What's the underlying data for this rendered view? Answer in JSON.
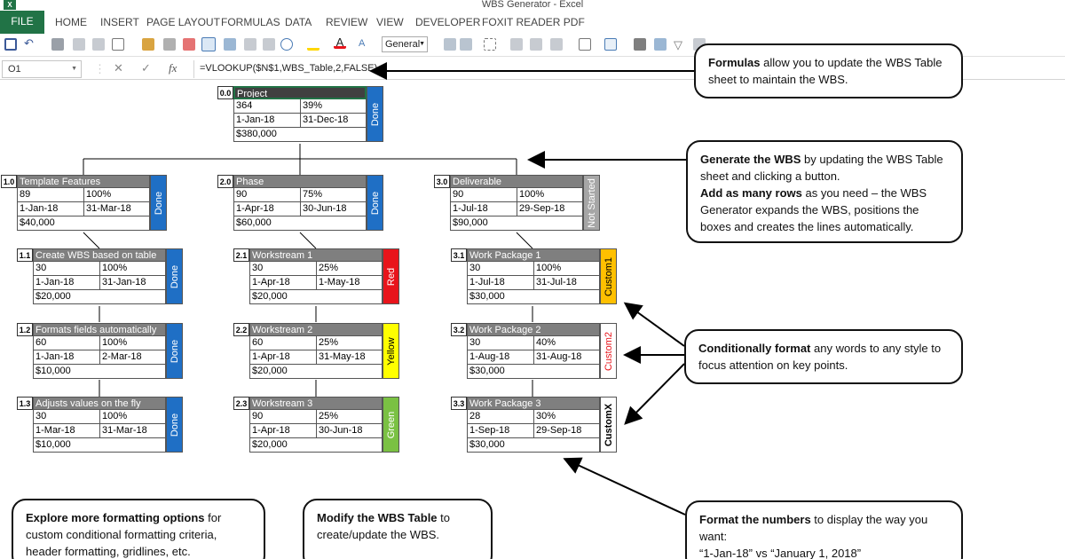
{
  "window": {
    "app_icon_label": "X",
    "title": "WBS Generator - Excel"
  },
  "ribbon": {
    "file_tab": "FILE",
    "tabs": [
      "HOME",
      "INSERT",
      "PAGE LAYOUT",
      "FORMULAS",
      "DATA",
      "REVIEW",
      "VIEW",
      "DEVELOPER",
      "FOXIT READER PDF"
    ]
  },
  "toolbar": {
    "number_format": "General"
  },
  "formula_bar": {
    "cell_ref": "O1",
    "cancel_icon": "✕",
    "enter_icon": "✓",
    "fx_label": "fx",
    "formula": "=VLOOKUP($N$1,WBS_Table,2,FALSE)"
  },
  "wbs": {
    "root": {
      "num": "0.0",
      "title": "Project",
      "a": "364",
      "b": "39%",
      "start": "1-Jan-18",
      "end": "31-Dec-18",
      "cost": "$380,000",
      "status": "Done"
    },
    "l1": [
      {
        "num": "1.0",
        "title": "Template Features",
        "a": "89",
        "b": "100%",
        "start": "1-Jan-18",
        "end": "31-Mar-18",
        "cost": "$40,000",
        "status": "Done"
      },
      {
        "num": "2.0",
        "title": "Phase",
        "a": "90",
        "b": "75%",
        "start": "1-Apr-18",
        "end": "30-Jun-18",
        "cost": "$60,000",
        "status": "Done"
      },
      {
        "num": "3.0",
        "title": "Deliverable",
        "a": "90",
        "b": "100%",
        "start": "1-Jul-18",
        "end": "29-Sep-18",
        "cost": "$90,000",
        "status": "Not Started"
      }
    ],
    "c1": [
      {
        "num": "1.1",
        "title": "Create WBS based on table",
        "a": "30",
        "b": "100%",
        "start": "1-Jan-18",
        "end": "31-Jan-18",
        "cost": "$20,000",
        "status": "Done"
      },
      {
        "num": "1.2",
        "title": "Formats fields automatically",
        "a": "60",
        "b": "100%",
        "start": "1-Jan-18",
        "end": "2-Mar-18",
        "cost": "$10,000",
        "status": "Done"
      },
      {
        "num": "1.3",
        "title": "Adjusts values on the fly",
        "a": "30",
        "b": "100%",
        "start": "1-Mar-18",
        "end": "31-Mar-18",
        "cost": "$10,000",
        "status": "Done"
      }
    ],
    "c2": [
      {
        "num": "2.1",
        "title": "Workstream 1",
        "a": "30",
        "b": "25%",
        "start": "1-Apr-18",
        "end": "1-May-18",
        "cost": "$20,000",
        "status": "Red"
      },
      {
        "num": "2.2",
        "title": "Workstream 2",
        "a": "60",
        "b": "25%",
        "start": "1-Apr-18",
        "end": "31-May-18",
        "cost": "$20,000",
        "status": "Yellow"
      },
      {
        "num": "2.3",
        "title": "Workstream 3",
        "a": "90",
        "b": "25%",
        "start": "1-Apr-18",
        "end": "30-Jun-18",
        "cost": "$20,000",
        "status": "Green"
      }
    ],
    "c3": [
      {
        "num": "3.1",
        "title": "Work Package 1",
        "a": "30",
        "b": "100%",
        "start": "1-Jul-18",
        "end": "31-Jul-18",
        "cost": "$30,000",
        "status": "Custom1"
      },
      {
        "num": "3.2",
        "title": "Work Package 2",
        "a": "30",
        "b": "40%",
        "start": "1-Aug-18",
        "end": "31-Aug-18",
        "cost": "$30,000",
        "status": "Custom2"
      },
      {
        "num": "3.3",
        "title": "Work Package 3",
        "a": "28",
        "b": "30%",
        "start": "1-Sep-18",
        "end": "29-Sep-18",
        "cost": "$30,000",
        "status": "CustomX"
      }
    ]
  },
  "status_colors": {
    "Done": {
      "bg": "#1f6fc5",
      "fg": "#ffffff"
    },
    "Not Started": {
      "bg": "#a6a6a6",
      "fg": "#ffffff"
    },
    "Red": {
      "bg": "#e8141b",
      "fg": "#ffffff"
    },
    "Yellow": {
      "bg": "#ffff00",
      "fg": "#000000"
    },
    "Green": {
      "bg": "#7ac143",
      "fg": "#ffffff"
    },
    "Custom1": {
      "bg": "#ffc000",
      "fg": "#000000"
    },
    "Custom2": {
      "bg": "#ffffff",
      "fg": "#e8141b"
    },
    "CustomX": {
      "bg": "#ffffff",
      "fg": "#000000"
    }
  },
  "callouts": {
    "formulas": {
      "bold": "Formulas",
      "text": " allow you to update the WBS Table sheet to maintain the WBS."
    },
    "generate": {
      "bold1": "Generate the WBS",
      "text1": " by updating the WBS Table sheet and clicking a button.",
      "bold2": "Add as many rows",
      "text2": " as you need – the WBS Generator expands the WBS, positions the boxes and creates the lines automatically."
    },
    "conditional": {
      "bold": "Conditionally format",
      "text": " any words to any style to focus attention on key points."
    },
    "explore": {
      "bold": "Explore more formatting options",
      "text": " for custom conditional formatting criteria, header formatting, gridlines, etc."
    },
    "modify": {
      "bold": "Modify the WBS Table",
      "text": " to create/update the WBS."
    },
    "numbers": {
      "bold": "Format the numbers",
      "text": " to display the way you want:",
      "example": "“1-Jan-18” vs “January 1, 2018”"
    }
  }
}
